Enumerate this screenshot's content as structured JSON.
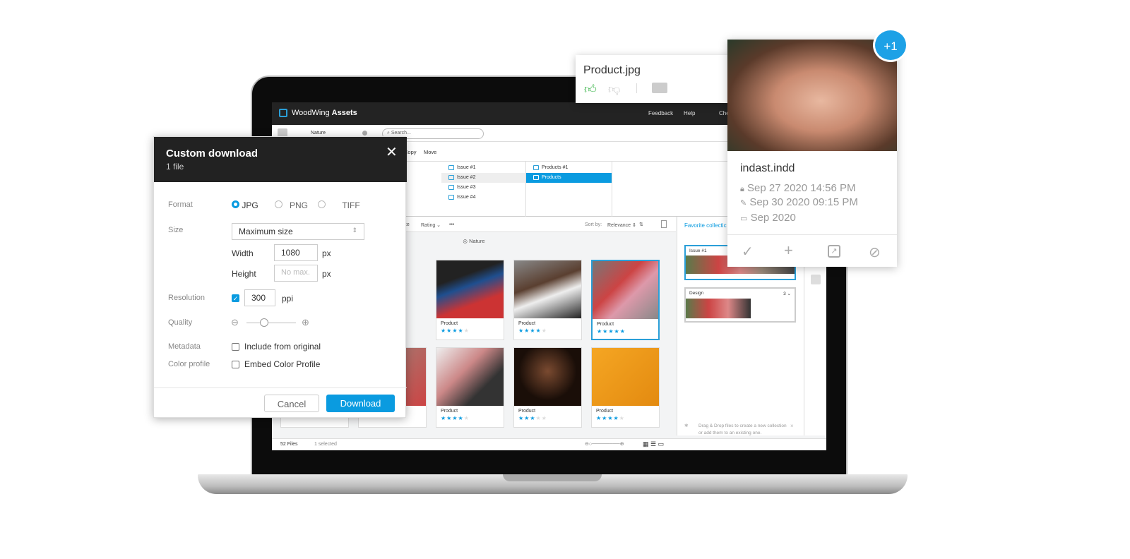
{
  "app": {
    "brand_light": "WoodWing",
    "brand_bold": "Assets",
    "nav": [
      "Feedback",
      "Help",
      "Che"
    ],
    "search_placeholder": "Search...",
    "folder": "Nature",
    "actions": [
      "Copy",
      "Move"
    ]
  },
  "columns": {
    "issues": [
      "Issue #1",
      "Issue #2",
      "Issue #3",
      "Issue #4"
    ],
    "products": [
      "Products #1",
      "Products"
    ]
  },
  "grid": {
    "toolbar": [
      "ete",
      "Rating",
      "•••"
    ],
    "sort_label": "Sort by:",
    "sort_value": "Relevance",
    "header": "Nature",
    "cards": [
      {
        "label": "",
        "rating": 4
      },
      {
        "label": "Product",
        "rating": 4
      },
      {
        "label": "Product",
        "rating": 4
      },
      {
        "label": "Product",
        "rating": 5,
        "selected": true
      },
      {
        "label": "",
        "rating": 4
      },
      {
        "label": "",
        "rating": 1
      },
      {
        "label": "Product",
        "rating": 4
      },
      {
        "label": "Product",
        "rating": 3
      },
      {
        "label": "Product",
        "rating": 4
      }
    ]
  },
  "favorites": {
    "title": "Favorite collectic",
    "collections": [
      {
        "name": "Issue #1"
      },
      {
        "name": "Design",
        "count": "3"
      }
    ],
    "hint": "Drag & Drop files to create a new collection or add them to an existing one."
  },
  "status": {
    "files": "52 Files",
    "selected": "1 selected"
  },
  "dialog": {
    "title": "Custom download",
    "subtitle": "1 file",
    "format_label": "Format",
    "formats": [
      "JPG",
      "PNG",
      "TIFF"
    ],
    "format_selected": "JPG",
    "size_label": "Size",
    "size_value": "Maximum size",
    "width_label": "Width",
    "width_value": "1080",
    "height_label": "Height",
    "height_placeholder": "No max.",
    "unit_px": "px",
    "resolution_label": "Resolution",
    "resolution_value": "300",
    "unit_ppi": "ppi",
    "resolution_checked": true,
    "quality_label": "Quality",
    "quality_fraction": 0.35,
    "metadata_label": "Metadata",
    "metadata_option": "Include from original",
    "color_label": "Color profile",
    "color_option": "Embed Color Profile",
    "cancel": "Cancel",
    "download": "Download"
  },
  "product_card": {
    "filename": "Product.jpg"
  },
  "info_card": {
    "filename": "indast.indd",
    "created": "Sep 27 2020 14:56 PM",
    "modified": "Sep 30 2020 09:15 PM",
    "folder_date": "Sep 2020"
  },
  "badge": "+1",
  "colors": {
    "accent": "#0a9be0",
    "dark": "#222222",
    "like": "#3bb54a"
  }
}
